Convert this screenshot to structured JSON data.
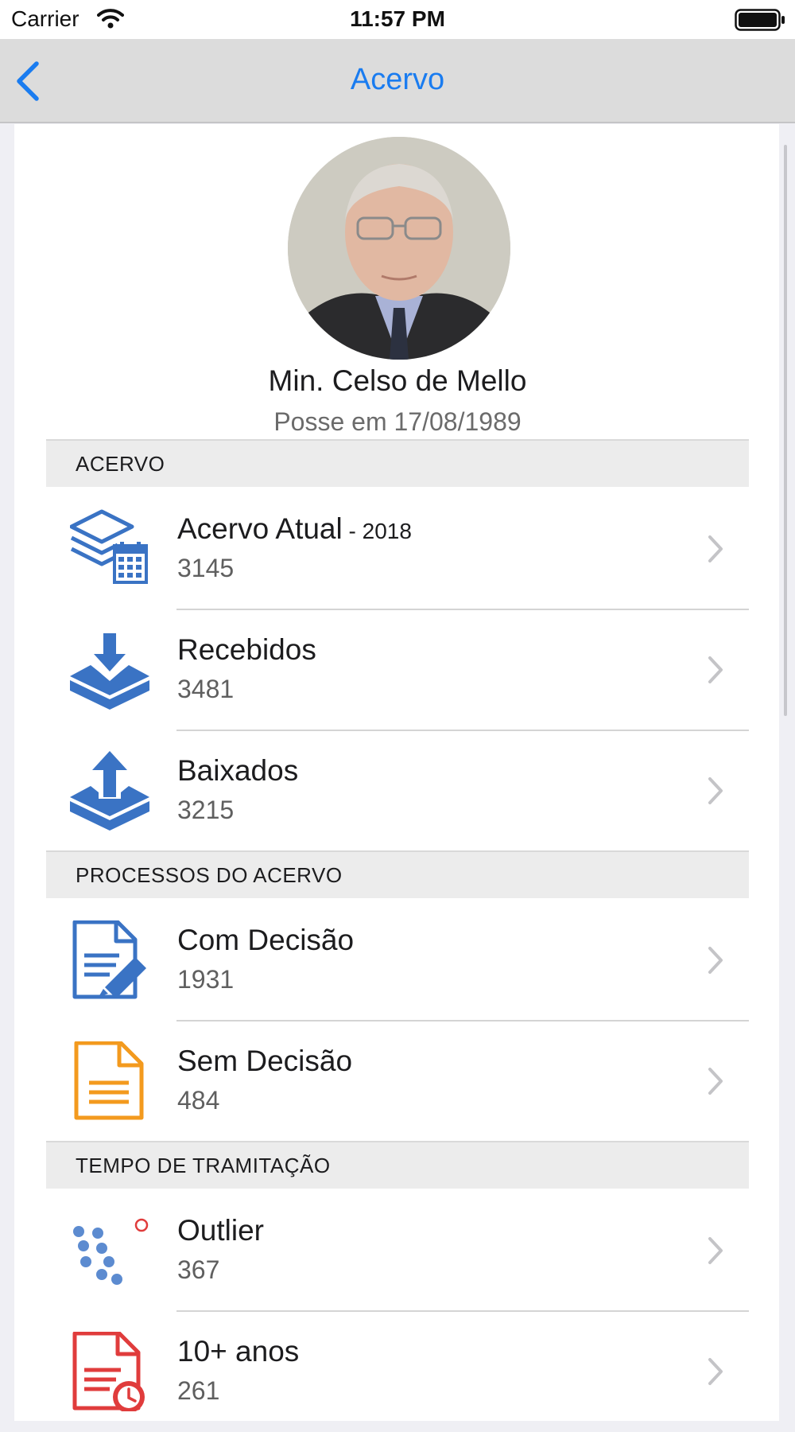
{
  "status_bar": {
    "carrier": "Carrier",
    "time": "11:57 PM"
  },
  "nav": {
    "title": "Acervo",
    "back_icon": "chevron-left-icon"
  },
  "profile": {
    "name": "Min. Celso de Mello",
    "subtitle": "Posse em 17/08/1989"
  },
  "sections": [
    {
      "header": "ACERVO",
      "rows": [
        {
          "title": "Acervo Atual",
          "suffix": " - 2018",
          "count": "3145",
          "icon": "stack-calendar-icon"
        },
        {
          "title": "Recebidos",
          "count": "3481",
          "icon": "inbox-download-icon"
        },
        {
          "title": "Baixados",
          "count": "3215",
          "icon": "outbox-upload-icon"
        }
      ]
    },
    {
      "header": "PROCESSOS DO ACERVO",
      "rows": [
        {
          "title": "Com Decisão",
          "count": "1931",
          "icon": "document-pen-icon"
        },
        {
          "title": "Sem Decisão",
          "count": "484",
          "icon": "document-lines-icon"
        }
      ]
    },
    {
      "header": "TEMPO DE TRAMITAÇÃO",
      "rows": [
        {
          "title": "Outlier",
          "count": "367",
          "icon": "scatter-outlier-icon"
        },
        {
          "title": "10+ anos",
          "count": "261",
          "icon": "document-clock-icon"
        }
      ]
    }
  ],
  "colors": {
    "accent": "#1a7cf0",
    "icon_blue": "#3a73c4",
    "icon_orange": "#f39a1e",
    "icon_red": "#e03c3c"
  }
}
